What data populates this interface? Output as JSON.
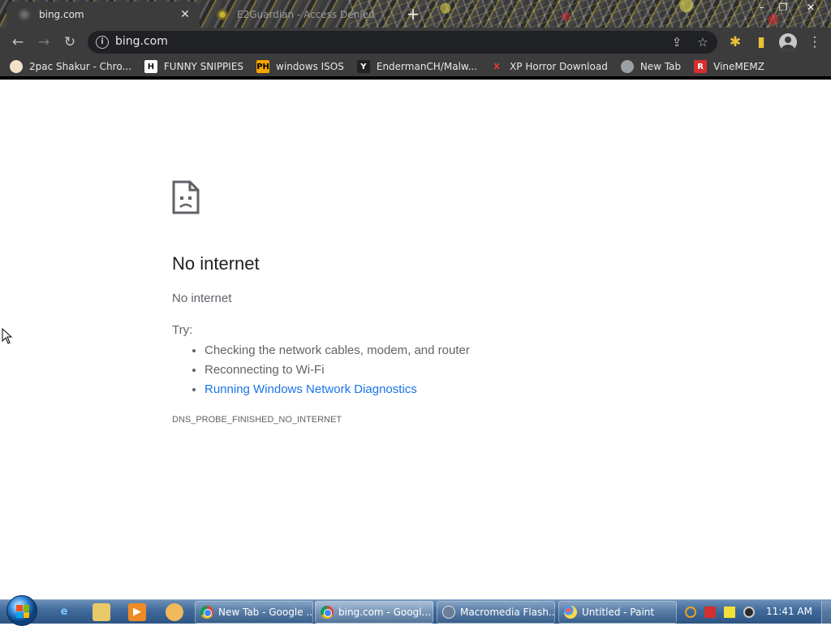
{
  "browser": {
    "tabs": [
      {
        "title": "bing.com",
        "close": "✕"
      },
      {
        "title": "E2Guardian - Access Denied"
      }
    ],
    "new_tab_glyph": "+",
    "window_controls": {
      "minimize": "–",
      "restore": "❐",
      "close": "✕"
    },
    "nav": {
      "back": "←",
      "forward": "→",
      "reload": "↻"
    },
    "omnibox": {
      "info_glyph": "i",
      "url": "bing.com"
    },
    "toolbar_icons": {
      "share": "⇪",
      "star": "☆",
      "extensions": "✱",
      "sidepanel": "▮",
      "menu": "⋮"
    },
    "bookmarks": [
      {
        "label": "2pac Shakur - Chro...",
        "icon": "",
        "icon_color": "#c0392b",
        "icon_bg": "#f2e3c6"
      },
      {
        "label": "FUNNY SNIPPIES",
        "icon": "H",
        "icon_color": "#111",
        "icon_bg": "#ffffff"
      },
      {
        "label": "windows ISOS",
        "icon": "PH",
        "icon_color": "#000",
        "icon_bg": "#f7a400"
      },
      {
        "label": "EndermanCH/Malw...",
        "icon": "Y",
        "icon_color": "#fff",
        "icon_bg": "#222"
      },
      {
        "label": "XP Horror Download",
        "icon": "X",
        "icon_color": "#e53935",
        "icon_bg": "transparent"
      },
      {
        "label": "New Tab",
        "icon": "",
        "icon_color": "#fff",
        "icon_bg": "#9aa0a6"
      },
      {
        "label": "VineMEMZ",
        "icon": "R",
        "icon_color": "#fff",
        "icon_bg": "#d32f2f"
      }
    ]
  },
  "error_page": {
    "title": "No internet",
    "subtitle": "No internet",
    "try_label": "Try:",
    "suggestions": [
      "Checking the network cables, modem, and router",
      "Reconnecting to Wi-Fi"
    ],
    "diagnostics_link": "Running Windows Network Diagnostics",
    "error_code": "DNS_PROBE_FINISHED_NO_INTERNET"
  },
  "taskbar": {
    "quick_launch": [
      "internet-explorer-icon",
      "folder-icon",
      "media-player-icon",
      "app-icon"
    ],
    "tasks": [
      {
        "label": "New Tab - Google ...",
        "icon": "chrome-icon"
      },
      {
        "label": "bing.com - Googl...",
        "icon": "chrome-icon"
      },
      {
        "label": "Macromedia Flash...",
        "icon": "flash-icon"
      },
      {
        "label": "Untitled - Paint",
        "icon": "paint-icon"
      }
    ],
    "clock": "11:41 AM"
  },
  "colors": {
    "chrome_dark": "#3c3c3c",
    "omnibox": "#202124",
    "link": "#1a73e8",
    "text_secondary": "#5f6368",
    "taskbar": "#3f6a9a"
  }
}
